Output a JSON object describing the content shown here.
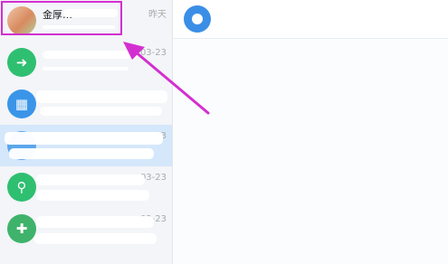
{
  "chats": [
    {
      "title": "金厚…",
      "preview": "",
      "time": "昨天",
      "avatar_color": "#e7a07a",
      "avatar_glyph": "",
      "avatar_icon": "photo-avatar"
    },
    {
      "title": "",
      "preview": "",
      "time": "03-23",
      "avatar_color": "#2fbf71",
      "avatar_glyph": "➜",
      "avatar_icon": "file-transfer-icon"
    },
    {
      "title": "",
      "preview": "",
      "time": "",
      "avatar_color": "#3a95e8",
      "avatar_glyph": "▦",
      "avatar_icon": "apps-icon"
    },
    {
      "title": "",
      "preview": "",
      "time": "03",
      "avatar_color": "#5aa6ec",
      "avatar_glyph": "",
      "avatar_icon": "cloud-icon"
    },
    {
      "title": "",
      "preview": "",
      "time": "03-23",
      "avatar_color": "#2fbf71",
      "avatar_glyph": "⚲",
      "avatar_icon": "contact-icon"
    },
    {
      "title": "",
      "preview": "",
      "time": "03-23",
      "avatar_color": "#3fb36b",
      "avatar_glyph": "✚",
      "avatar_icon": "shield-icon"
    }
  ],
  "header": {
    "title": ""
  },
  "annotation": {
    "color": "#d32fd0"
  }
}
